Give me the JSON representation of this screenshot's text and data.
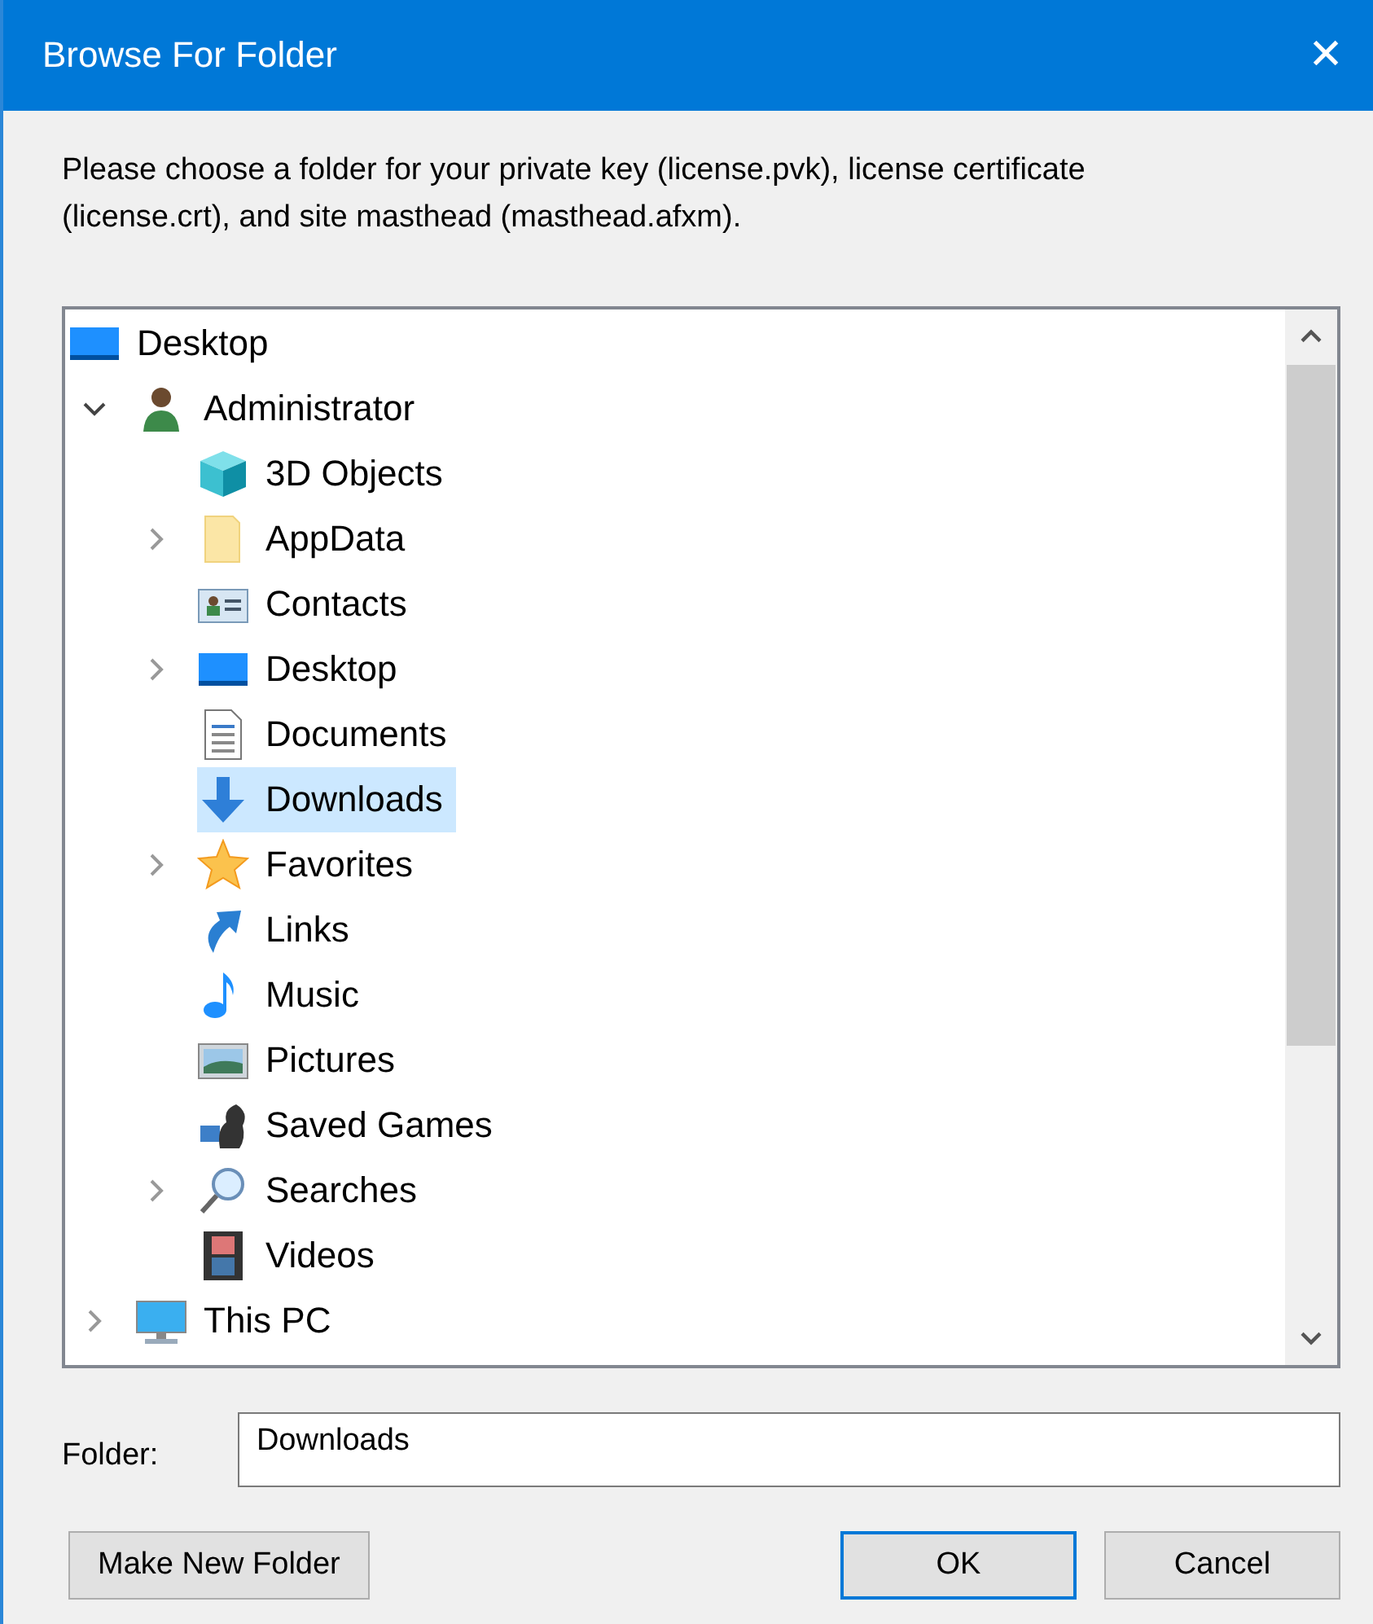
{
  "window": {
    "title": "Browse For Folder",
    "close": "✕"
  },
  "description": "Please choose a folder for your private key (license.pvk), license certificate (license.crt), and site masthead (masthead.afxm).",
  "tree": [
    {
      "label": "Desktop",
      "selected": false,
      "children": [
        {
          "label": "Administrator",
          "kind": "expanded",
          "selected": false,
          "children": [
            {
              "label": "3D Objects",
              "kind": "leaf",
              "selected": false
            },
            {
              "label": "AppData",
              "kind": "collapsed",
              "selected": false
            },
            {
              "label": "Contacts",
              "kind": "leaf",
              "selected": false
            },
            {
              "label": "Desktop",
              "kind": "collapsed",
              "selected": false
            },
            {
              "label": "Documents",
              "kind": "leaf",
              "selected": false
            },
            {
              "label": "Downloads",
              "kind": "leaf",
              "selected": true
            },
            {
              "label": "Favorites",
              "kind": "collapsed",
              "selected": false
            },
            {
              "label": "Links",
              "kind": "leaf",
              "selected": false
            },
            {
              "label": "Music",
              "kind": "leaf",
              "selected": false
            },
            {
              "label": "Pictures",
              "kind": "leaf",
              "selected": false
            },
            {
              "label": "Saved Games",
              "kind": "leaf",
              "selected": false
            },
            {
              "label": "Searches",
              "kind": "collapsed",
              "selected": false
            },
            {
              "label": "Videos",
              "kind": "leaf",
              "selected": false
            }
          ]
        },
        {
          "label": "This PC",
          "kind": "collapsed",
          "selected": false
        }
      ]
    }
  ],
  "folder": {
    "label": "Folder:",
    "value": "Downloads"
  },
  "buttons": [
    {
      "label": "Make New Folder",
      "default": false
    },
    {
      "label": "OK",
      "default": true
    },
    {
      "label": "Cancel",
      "default": false
    }
  ]
}
